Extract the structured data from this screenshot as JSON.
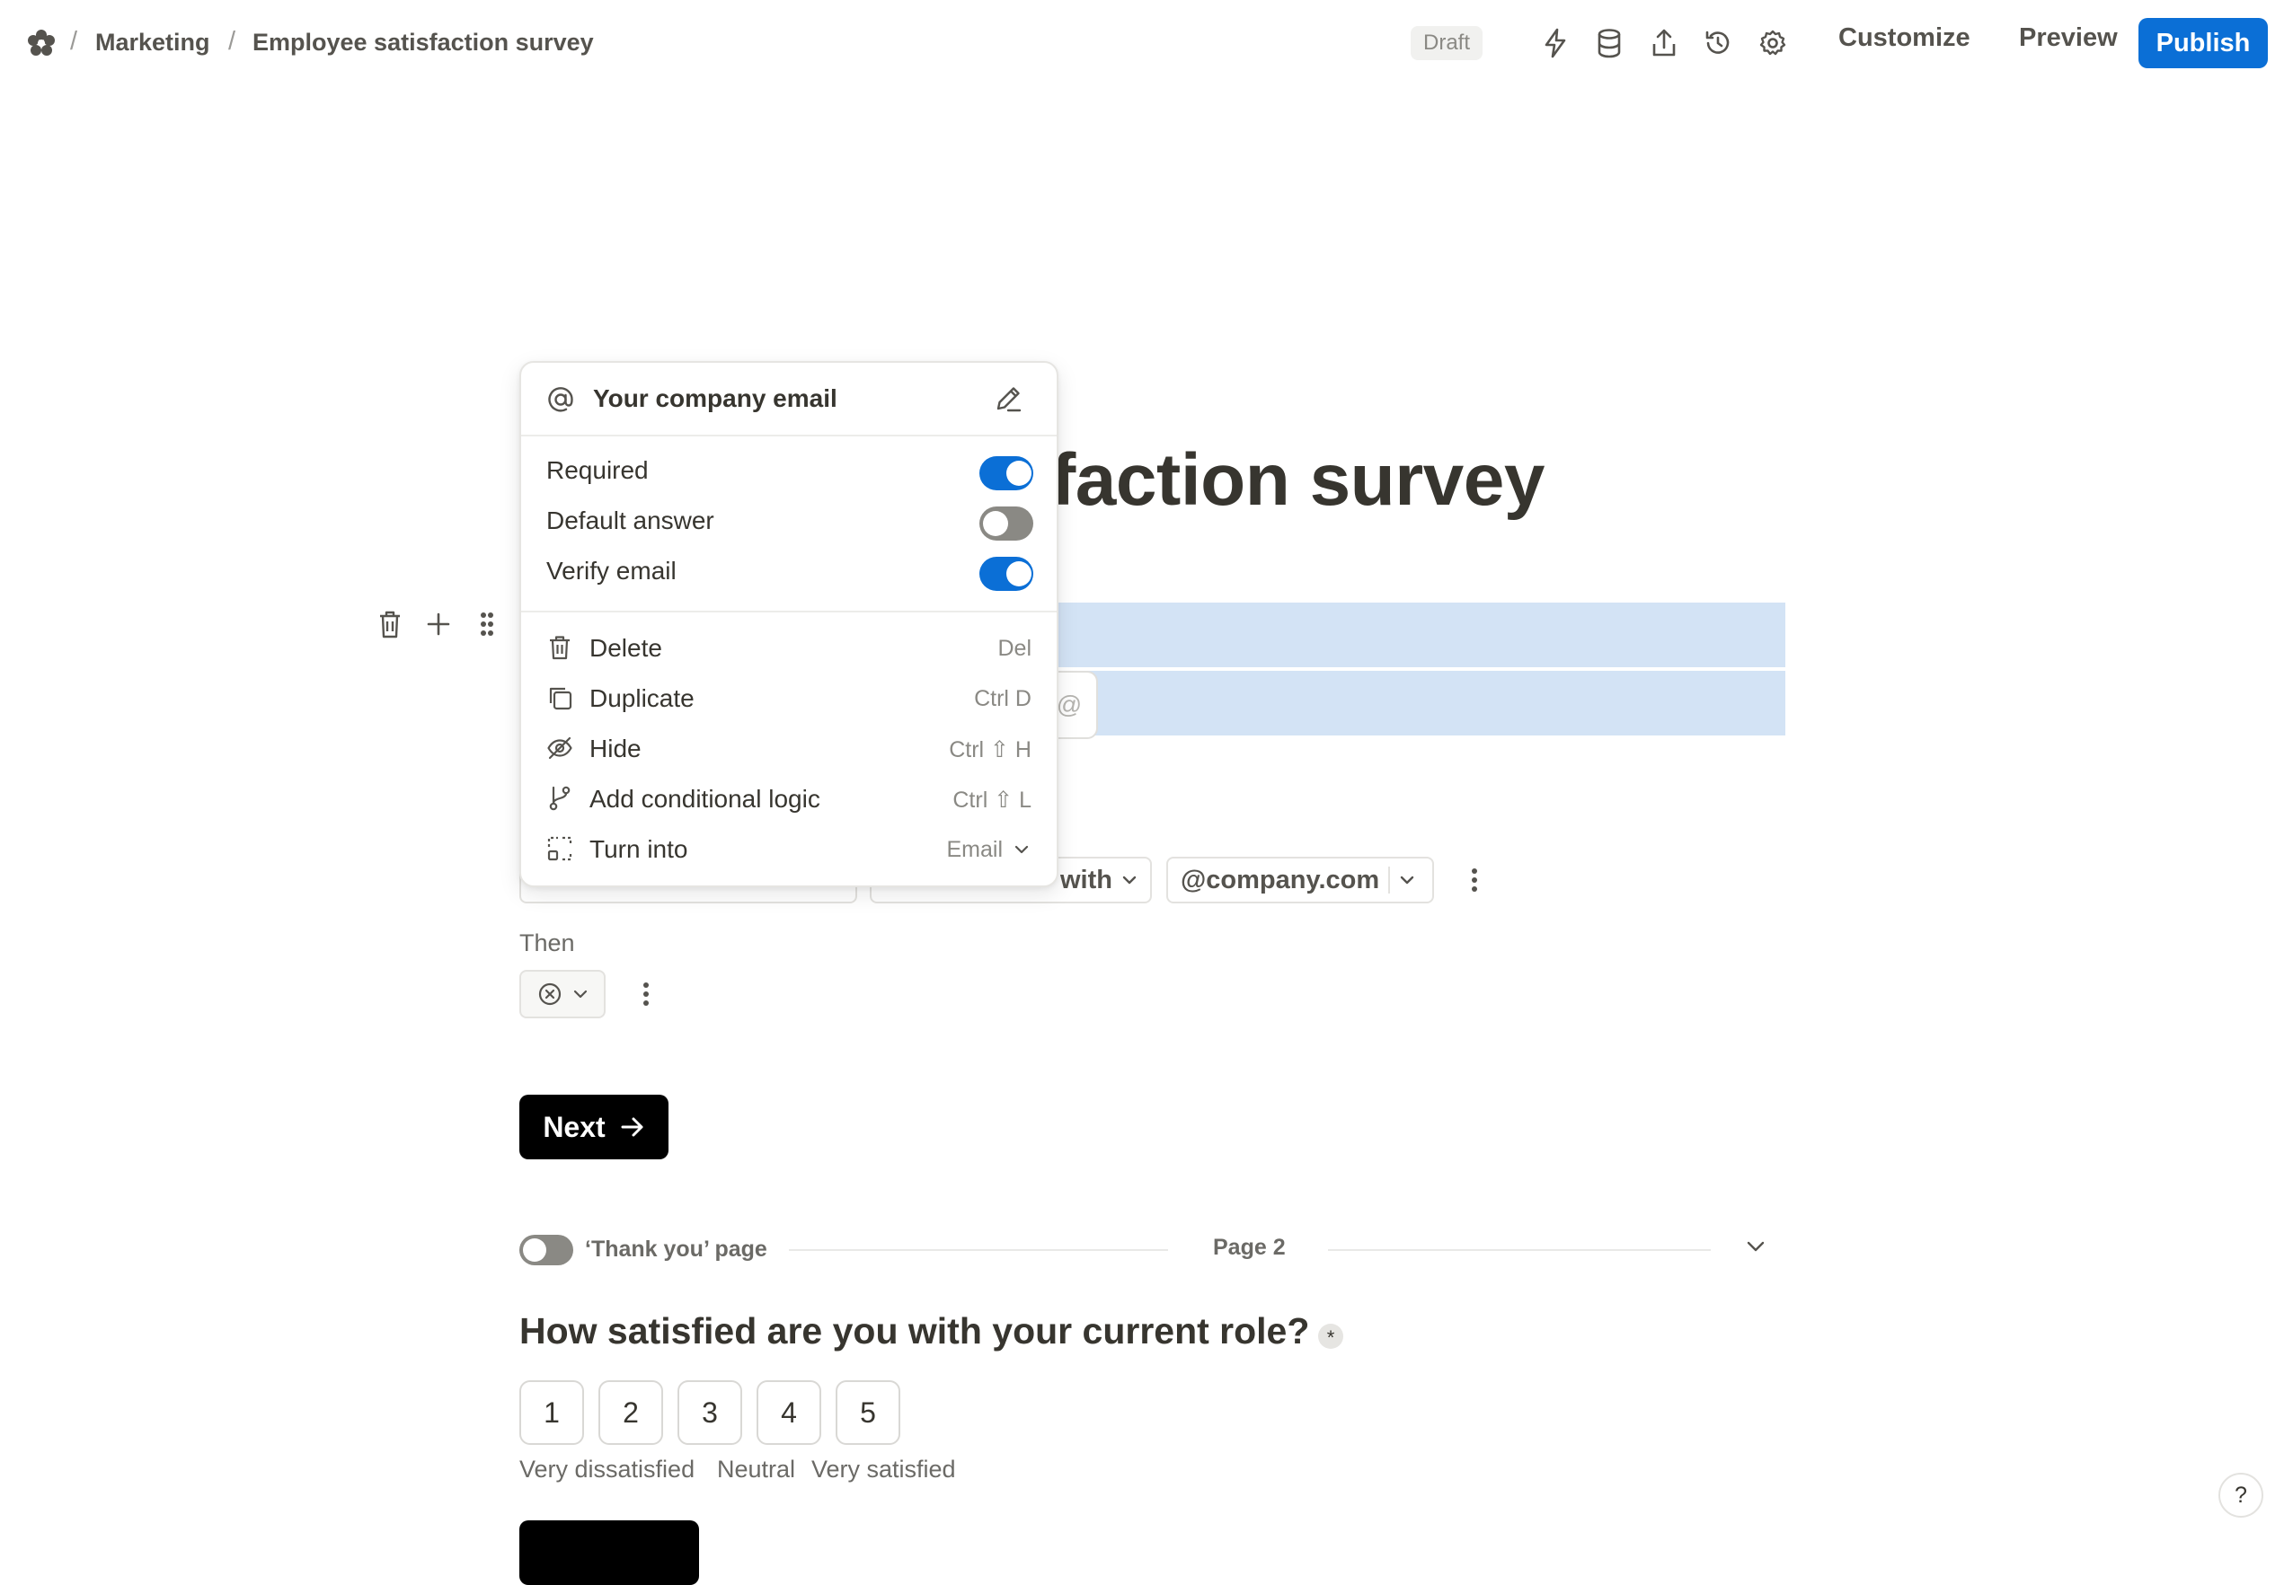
{
  "breadcrumb": {
    "logo_icon": "asterisk-logo-icon",
    "items": [
      "Marketing",
      "Employee satisfaction survey"
    ]
  },
  "header": {
    "status_badge": "Draft",
    "icons": [
      "bolt-icon",
      "database-icon",
      "share-icon",
      "history-icon",
      "gear-icon"
    ],
    "customize_label": "Customize",
    "preview_label": "Preview",
    "publish_label": "Publish"
  },
  "colors": {
    "accent": "#0b6fd6",
    "selection": "#d3e3f5",
    "text": "#37352f",
    "muted": "#6b6a66",
    "button_dark": "#000000"
  },
  "form": {
    "title_visible": "faction survey",
    "email_field_icon": "@",
    "logic": {
      "condition_value": "with",
      "domain_value": "@company.com",
      "then_label": "Then"
    },
    "next_label": "Next",
    "page_bar": {
      "thank_you_label": "‘Thank you’ page",
      "page_label": "Page 2",
      "thank_you_enabled": false
    },
    "question": {
      "text": "How satisfied are you with your current role?",
      "required_mark": "*",
      "options": [
        "1",
        "2",
        "3",
        "4",
        "5"
      ],
      "scale_labels": [
        "Very dissatisfied",
        "Neutral",
        "Very satisfied"
      ]
    },
    "help_label": "?"
  },
  "popover": {
    "title": "Your company email",
    "title_icon": "at-icon",
    "edit_icon": "pencil-icon",
    "options": [
      {
        "label": "Required",
        "enabled": true
      },
      {
        "label": "Default answer",
        "enabled": false
      },
      {
        "label": "Verify email",
        "enabled": true
      }
    ],
    "actions": [
      {
        "label": "Delete",
        "shortcut": "Del",
        "icon": "trash-icon"
      },
      {
        "label": "Duplicate",
        "shortcut": "Ctrl D",
        "icon": "duplicate-icon"
      },
      {
        "label": "Hide",
        "shortcut": "Ctrl ⇧ H",
        "icon": "eye-off-icon"
      },
      {
        "label": "Add conditional logic",
        "shortcut": "Ctrl ⇧ L",
        "icon": "branch-icon"
      },
      {
        "label": "Turn into",
        "shortcut": "Email",
        "icon": "transform-icon"
      }
    ]
  }
}
